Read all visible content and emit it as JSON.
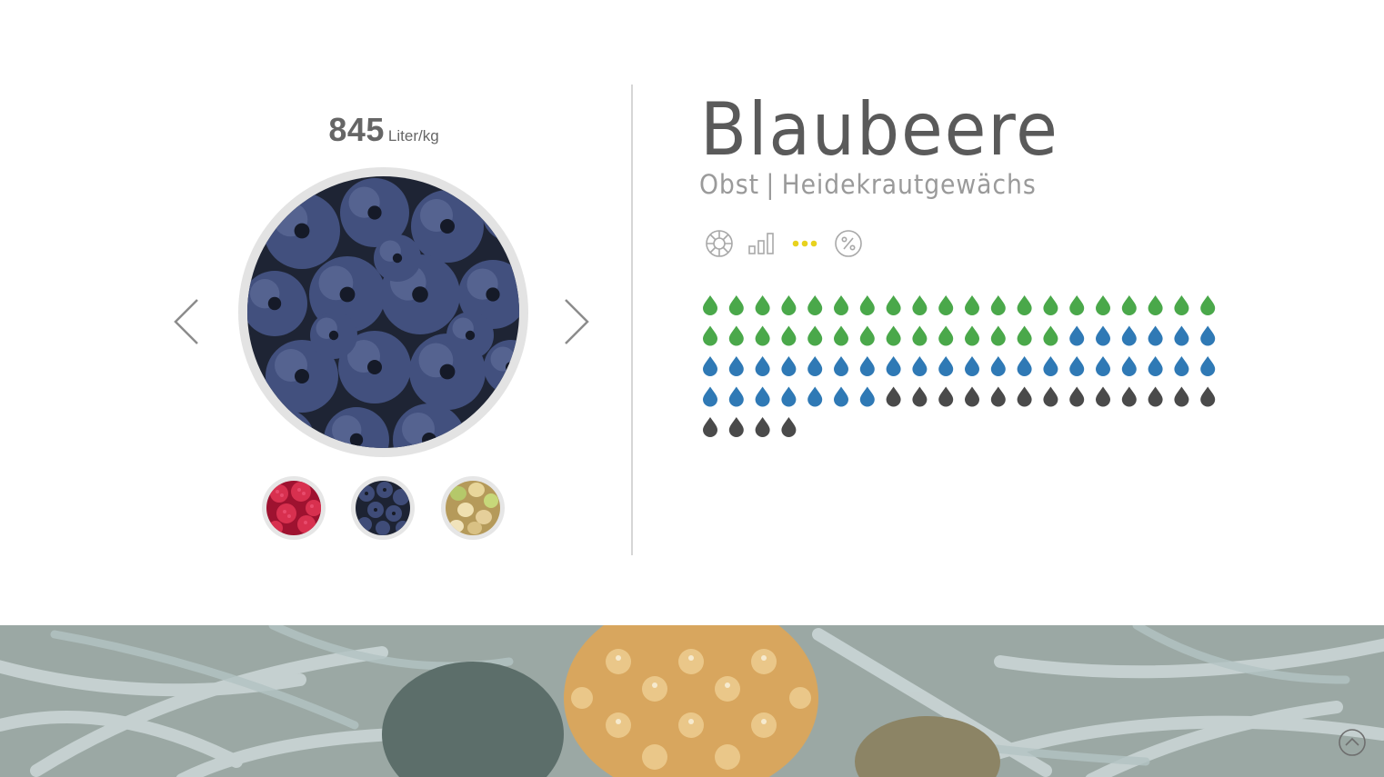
{
  "product": {
    "value": "845",
    "unit": "Liter/kg",
    "name": "Blaubeere",
    "category": "Obst",
    "separator": "|",
    "family": "Heidekrautgewächs"
  },
  "view_modes": [
    {
      "name": "globe-icon",
      "active": false
    },
    {
      "name": "bar-chart-icon",
      "active": false
    },
    {
      "name": "dots-icon",
      "active": true
    },
    {
      "name": "percent-icon",
      "active": false
    }
  ],
  "water_drops": {
    "per_row": 20,
    "counts": {
      "green": 34,
      "blue": 33,
      "grey": 17
    },
    "colors": {
      "green": "#4aa84a",
      "blue": "#2f79b5",
      "grey": "#4a4a4a"
    }
  },
  "thumbnails": [
    {
      "name": "raspberry"
    },
    {
      "name": "blueberry",
      "active": true
    },
    {
      "name": "grape"
    }
  ],
  "colors": {
    "accent_yellow": "#e8d21e",
    "icon_grey": "#a8a8a8"
  }
}
